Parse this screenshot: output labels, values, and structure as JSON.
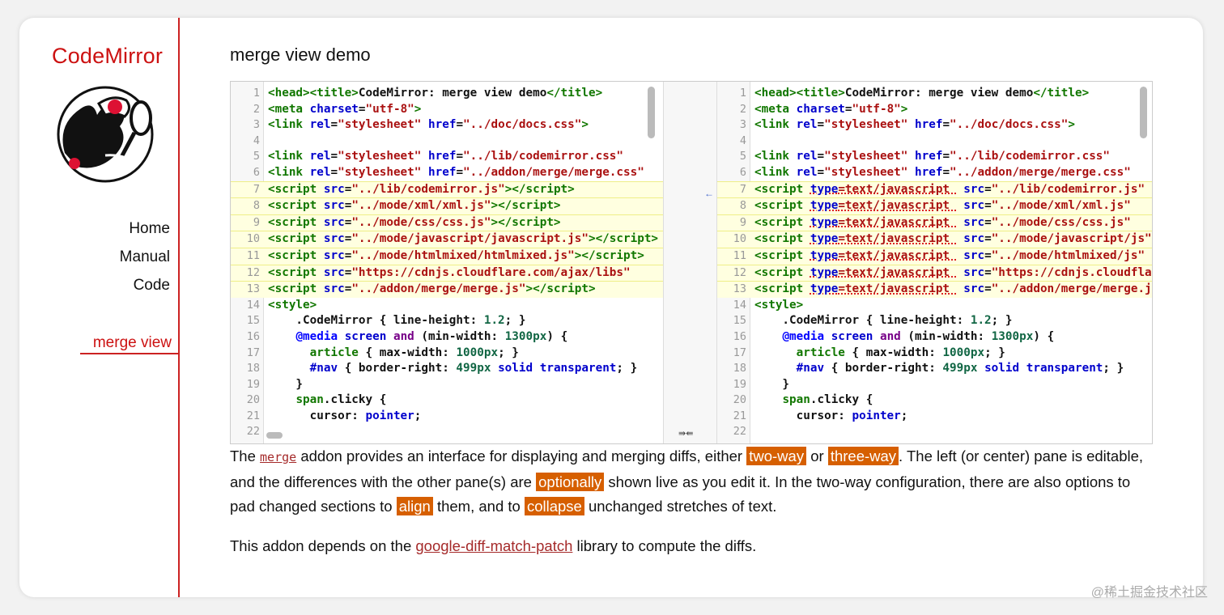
{
  "brand": {
    "name": "CodeMirror"
  },
  "nav": {
    "items": [
      "Home",
      "Manual",
      "Code"
    ],
    "active": "merge view"
  },
  "main": {
    "title": "merge view demo"
  },
  "merge_view": {
    "left_lines": [
      {
        "n": "1",
        "html": "<span class='tag'>&lt;head&gt;&lt;title&gt;</span>CodeMirror: merge view demo<span class='tag'>&lt;/title&gt;</span>"
      },
      {
        "n": "2",
        "html": "<span class='tag'>&lt;meta</span> <span class='attr'>charset</span>=<span class='str'>\"utf-8\"</span><span class='tag'>&gt;</span>"
      },
      {
        "n": "3",
        "html": "<span class='tag'>&lt;link</span> <span class='attr'>rel</span>=<span class='str'>\"stylesheet\"</span> <span class='attr'>href</span>=<span class='str'>\"../doc/docs.css\"</span><span class='tag'>&gt;</span>"
      },
      {
        "n": "4",
        "html": ""
      },
      {
        "n": "5",
        "html": "<span class='tag'>&lt;link</span> <span class='attr'>rel</span>=<span class='str'>\"stylesheet\"</span> <span class='attr'>href</span>=<span class='str'>\"../lib/codemirror.css\"</span>"
      },
      {
        "n": "6",
        "html": "<span class='tag'>&lt;link</span> <span class='attr'>rel</span>=<span class='str'>\"stylesheet\"</span> <span class='attr'>href</span>=<span class='str'>\"../addon/merge/merge.css\"</span>"
      },
      {
        "n": "7",
        "chg": true,
        "html": "<span class='tag'>&lt;script</span> <span class='attr'>src</span>=<span class='str'>\"../lib/codemirror.js\"</span><span class='tag'>&gt;&lt;/script&gt;</span>"
      },
      {
        "n": "8",
        "chg": true,
        "html": "<span class='tag'>&lt;script</span> <span class='attr'>src</span>=<span class='str'>\"../mode/xml/xml.js\"</span><span class='tag'>&gt;&lt;/script&gt;</span>"
      },
      {
        "n": "9",
        "chg": true,
        "html": "<span class='tag'>&lt;script</span> <span class='attr'>src</span>=<span class='str'>\"../mode/css/css.js\"</span><span class='tag'>&gt;&lt;/script&gt;</span>"
      },
      {
        "n": "10",
        "chg": true,
        "html": "<span class='tag'>&lt;script</span> <span class='attr'>src</span>=<span class='str'>\"../mode/javascript/javascript.js\"</span><span class='tag'>&gt;&lt;/script&gt;</span>"
      },
      {
        "n": "11",
        "chg": true,
        "html": "<span class='tag'>&lt;script</span> <span class='attr'>src</span>=<span class='str'>\"../mode/htmlmixed/htmlmixed.js\"</span><span class='tag'>&gt;&lt;/script&gt;</span>"
      },
      {
        "n": "12",
        "chg": true,
        "html": "<span class='tag'>&lt;script</span> <span class='attr'>src</span>=<span class='str'>\"https://cdnjs.cloudflare.com/ajax/libs\"</span>"
      },
      {
        "n": "13",
        "chg": true,
        "html": "<span class='tag'>&lt;script</span> <span class='attr'>src</span>=<span class='str'>\"../addon/merge/merge.js\"</span><span class='tag'>&gt;&lt;/script&gt;</span>"
      },
      {
        "n": "14",
        "html": "<span class='tag'>&lt;style&gt;</span>"
      },
      {
        "n": "15",
        "html": "    .CodeMirror { line-height: <span class='num'>1.2</span>; }"
      },
      {
        "n": "16",
        "html": "    <span class='def'>@media</span> <span class='attr'>screen</span> <span class='kw'>and</span> (min-width: <span class='num'>1300px</span>) {"
      },
      {
        "n": "17",
        "html": "      <span class='tag'>article</span> { max-width: <span class='num'>1000px</span>; }"
      },
      {
        "n": "18",
        "html": "      <span class='attr'>#nav</span> { border-right: <span class='num'>499px</span> <span class='attr'>solid</span> <span class='attr'>transparent</span>; }"
      },
      {
        "n": "19",
        "html": "    }"
      },
      {
        "n": "20",
        "html": "    <span class='tag'>span</span>.clicky {"
      },
      {
        "n": "21",
        "html": "      cursor: <span class='attr'>pointer</span>;"
      },
      {
        "n": "22",
        "html": ""
      }
    ],
    "right_lines": [
      {
        "n": "1",
        "html": "<span class='tag'>&lt;head&gt;&lt;title&gt;</span>CodeMirror: merge view demo<span class='tag'>&lt;/title&gt;</span>"
      },
      {
        "n": "2",
        "html": "<span class='tag'>&lt;meta</span> <span class='attr'>charset</span>=<span class='str'>\"utf-8\"</span><span class='tag'>&gt;</span>"
      },
      {
        "n": "3",
        "html": "<span class='tag'>&lt;link</span> <span class='attr'>rel</span>=<span class='str'>\"stylesheet\"</span> <span class='attr'>href</span>=<span class='str'>\"../doc/docs.css\"</span><span class='tag'>&gt;</span>"
      },
      {
        "n": "4",
        "html": ""
      },
      {
        "n": "5",
        "html": "<span class='tag'>&lt;link</span> <span class='attr'>rel</span>=<span class='str'>\"stylesheet\"</span> <span class='attr'>href</span>=<span class='str'>\"../lib/codemirror.css\"</span>"
      },
      {
        "n": "6",
        "html": "<span class='tag'>&lt;link</span> <span class='attr'>rel</span>=<span class='str'>\"stylesheet\"</span> <span class='attr'>href</span>=<span class='str'>\"../addon/merge/merge.css\"</span>"
      },
      {
        "n": "7",
        "chg": true,
        "html": "<span class='tag'>&lt;script</span> <span class='ins'><span class='attr'>type</span>=text/javascript </span> <span class='attr'>src</span>=<span class='str'>\"../lib/codemirror.js\"</span>"
      },
      {
        "n": "8",
        "chg": true,
        "html": "<span class='tag'>&lt;script</span> <span class='ins'><span class='attr'>type</span>=text/javascript </span> <span class='attr'>src</span>=<span class='str'>\"../mode/xml/xml.js\"</span>"
      },
      {
        "n": "9",
        "chg": true,
        "html": "<span class='tag'>&lt;script</span> <span class='ins'><span class='attr'>type</span>=text/javascript </span> <span class='attr'>src</span>=<span class='str'>\"../mode/css/css.js\"</span>"
      },
      {
        "n": "10",
        "chg": true,
        "html": "<span class='tag'>&lt;script</span> <span class='ins'><span class='attr'>type</span>=text/javascript </span> <span class='attr'>src</span>=<span class='str'>\"../mode/javascript/js\"</span>"
      },
      {
        "n": "11",
        "chg": true,
        "html": "<span class='tag'>&lt;script</span> <span class='ins'><span class='attr'>type</span>=text/javascript </span> <span class='attr'>src</span>=<span class='str'>\"../mode/htmlmixed/js\"</span>"
      },
      {
        "n": "12",
        "chg": true,
        "html": "<span class='tag'>&lt;script</span> <span class='ins'><span class='attr'>type</span>=text/javascript </span> <span class='attr'>src</span>=<span class='str'>\"https://cdnjs.cloudflare\"</span>"
      },
      {
        "n": "13",
        "chg": true,
        "html": "<span class='tag'>&lt;script</span> <span class='ins'><span class='attr'>type</span>=text/javascript </span> <span class='attr'>src</span>=<span class='str'>\"../addon/merge/merge.js\"</span>"
      },
      {
        "n": "14",
        "html": "<span class='tag'>&lt;style&gt;</span>"
      },
      {
        "n": "15",
        "html": "    .CodeMirror { line-height: <span class='num'>1.2</span>; }"
      },
      {
        "n": "16",
        "html": "    <span class='def'>@media</span> <span class='attr'>screen</span> <span class='kw'>and</span> (min-width: <span class='num'>1300px</span>) {"
      },
      {
        "n": "17",
        "html": "      <span class='tag'>article</span> { max-width: <span class='num'>1000px</span>; }"
      },
      {
        "n": "18",
        "html": "      <span class='attr'>#nav</span> { border-right: <span class='num'>499px</span> <span class='attr'>solid</span> <span class='attr'>transparent</span>; }"
      },
      {
        "n": "19",
        "html": "    }"
      },
      {
        "n": "20",
        "html": "    <span class='tag'>span</span>.clicky {"
      },
      {
        "n": "21",
        "html": "      cursor: <span class='attr'>pointer</span>;"
      },
      {
        "n": "22",
        "html": ""
      }
    ],
    "revert_arrow": "←",
    "sync_icon": "⇛⇚"
  },
  "description": {
    "p1_a": "The ",
    "merge_link": "merge",
    "p1_b": " addon provides an interface for displaying and merging diffs, either ",
    "two_way": "two-way",
    "p1_c": " or ",
    "three_way": "three-way",
    "p1_d": ". The left (or center) pane is editable, and the differences with the other pane(s) are ",
    "optionally": "optionally",
    "p1_e": " shown live as you edit it. In the two-way configuration, there are also options to pad changed sections to ",
    "align": "align",
    "p1_f": " them, and to ",
    "collapse": "collapse",
    "p1_g": " unchanged stretches of text.",
    "p2_a": "This addon depends on the ",
    "gdmp_link": "google-diff-match-patch",
    "p2_b": " library to compute the diffs."
  },
  "watermark": "@稀土掘金技术社区",
  "colors": {
    "accent": "#cc2222",
    "highlight": "#d65f00",
    "changed_bg": "#ffffe0"
  }
}
